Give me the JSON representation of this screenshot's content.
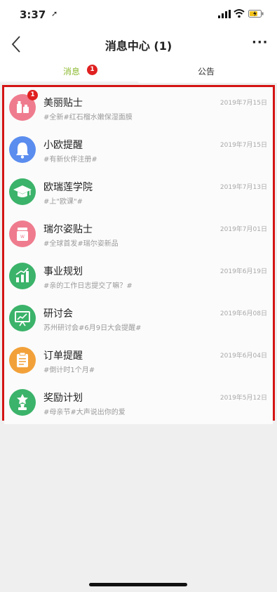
{
  "status_bar": {
    "time": "3:37"
  },
  "nav": {
    "title": "消息中心 (1)",
    "more": "···"
  },
  "tabs": [
    {
      "label": "消息",
      "badge": "1",
      "active": true
    },
    {
      "label": "公告",
      "active": false
    }
  ],
  "messages": [
    {
      "title": "美丽贴士",
      "subtitle": "#全新#红石榴水嫩保湿面膜",
      "date": "2019年7月15日",
      "badge": "1",
      "icon": "cosmetics-icon",
      "color": "#ef7c8e"
    },
    {
      "title": "小欧提醒",
      "subtitle": "#有新伙伴注册#",
      "date": "2019年7月15日",
      "icon": "bell-icon",
      "color": "#5b8def"
    },
    {
      "title": "欧瑞莲学院",
      "subtitle": "#上\"欧课\"#",
      "date": "2019年7月13日",
      "icon": "graduation-cap-icon",
      "color": "#3bb36a"
    },
    {
      "title": "瑞尔姿贴士",
      "subtitle": "#全球首发#瑞尔姿新品",
      "date": "2019年7月01日",
      "icon": "cream-jar-icon",
      "color": "#ef7c8e"
    },
    {
      "title": "事业规划",
      "subtitle": "#亲的工作日志提交了嘛？#",
      "date": "2019年6月19日",
      "icon": "growth-chart-icon",
      "color": "#3bb36a"
    },
    {
      "title": "研讨会",
      "subtitle": "苏州研讨会#6月9日大会提醒#",
      "date": "2019年6月08日",
      "icon": "presentation-board-icon",
      "color": "#3bb36a"
    },
    {
      "title": "订单提醒",
      "subtitle": "#倒计时1个月#",
      "date": "2019年6月04日",
      "icon": "clipboard-icon",
      "color": "#f2a13a"
    },
    {
      "title": "奖励计划",
      "subtitle": "#母亲节#大声说出你的爱",
      "date": "2019年5月12日",
      "icon": "trophy-icon",
      "color": "#3bb36a"
    }
  ]
}
